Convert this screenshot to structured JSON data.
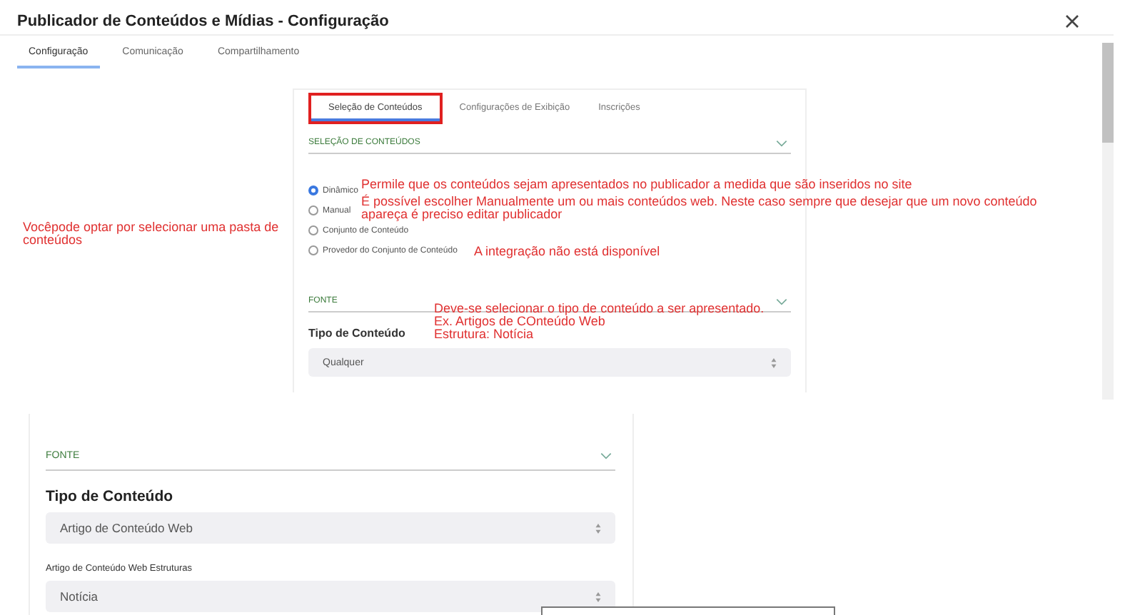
{
  "window": {
    "title": "Publicador de Conteúdos e Mídias - Configuração"
  },
  "tabs": [
    {
      "label": "Configuração",
      "selected": true
    },
    {
      "label": "Comunicação",
      "selected": false
    },
    {
      "label": "Compartilhamento",
      "selected": false
    }
  ],
  "content_panel": {
    "tabs": [
      {
        "label": "Seleção de Conteúdos",
        "selected": true,
        "highlighted": true
      },
      {
        "label": "Configurações de Exibição",
        "selected": false,
        "highlighted": false
      },
      {
        "label": "Inscrições",
        "selected": false,
        "highlighted": false
      }
    ],
    "section_title": "SELEÇÃO DE CONTEÚDOS",
    "options": [
      {
        "label": "Dinâmico",
        "selected": true
      },
      {
        "label": "Manual",
        "selected": false
      },
      {
        "label": "Conjunto de Conteúdo",
        "selected": false
      },
      {
        "label": "Provedor do Conjunto de Conteúdo",
        "selected": false
      }
    ],
    "source": {
      "title": "FONTE",
      "field_label": "Tipo de Conteúdo",
      "value": "Qualquer"
    }
  },
  "annotations": [
    {
      "lines": [
        "Permile que os conteúdos sejam apresentados no publicador a medida que são inseridos no site"
      ]
    },
    {
      "lines": [
        "É possível escolher Manualmente um ou mais conteúdos web. Neste caso sempre que desejar que um novo conteúdo",
        "apareça é preciso editar publicador"
      ]
    },
    {
      "lines": [
        "Vocêpode optar por selecionar uma pasta de",
        "conteúdos"
      ]
    },
    {
      "lines": [
        "A integração não está disponível"
      ]
    },
    {
      "lines": [
        "Deve-se selecionar o tipo de conteúdo a ser apresentado.",
        "Ex. Artigos de COnteúdo Web",
        "Estrutura: Notícia"
      ]
    }
  ],
  "detail_panel": {
    "title": "FONTE",
    "fields": [
      {
        "kind": "heading",
        "label": "Tipo de Conteúdo",
        "value": "Artigo de Conteúdo Web"
      },
      {
        "kind": "small",
        "label": "Artigo de Conteúdo Web Estruturas",
        "value": "Notícia"
      }
    ]
  }
}
